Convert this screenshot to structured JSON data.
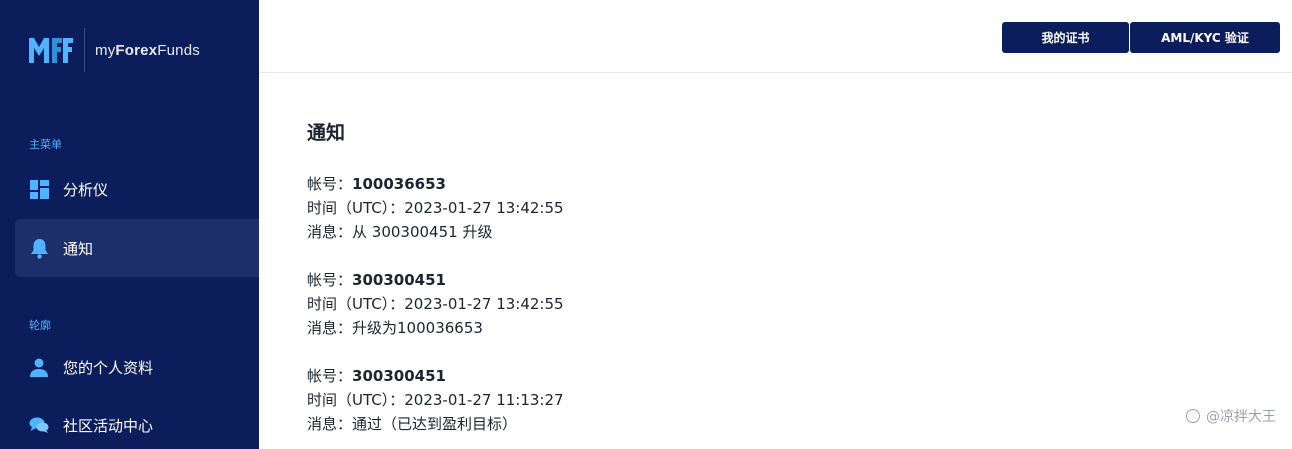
{
  "brand": {
    "name_prefix": "my",
    "name_bold": "Forex",
    "name_suffix": "Funds"
  },
  "sidebar": {
    "section_main": "主菜单",
    "section_profile": "轮廓",
    "items": [
      {
        "label": "分析仪",
        "icon": "dashboard-icon"
      },
      {
        "label": "通知",
        "icon": "bell-icon",
        "active": true
      },
      {
        "label": "您的个人资料",
        "icon": "user-icon"
      },
      {
        "label": "社区活动中心",
        "icon": "chat-icon"
      }
    ]
  },
  "header": {
    "btn_certificate": "我的证书",
    "btn_kyc": "AML/KYC 验证"
  },
  "main": {
    "title": "通知",
    "notices": [
      {
        "account_label": "帐号：",
        "account": "100036653",
        "time_label": "时间（UTC）：",
        "time": "2023-01-27 13:42:55",
        "message_label": "消息：",
        "message": "从 300300451 升级"
      },
      {
        "account_label": "帐号：",
        "account": "300300451",
        "time_label": "时间（UTC）：",
        "time": "2023-01-27 13:42:55",
        "message_label": "消息：",
        "message": "升级为100036653"
      },
      {
        "account_label": "帐号：",
        "account": "300300451",
        "time_label": "时间（UTC）：",
        "time": "2023-01-27 11:13:27",
        "message_label": "消息：",
        "message": "通过（已达到盈利目标）"
      }
    ]
  },
  "watermark": "@凉拌大王",
  "colors": {
    "sidebar_bg": "#0b1d5b",
    "active_item_bg": "#1d2f6b",
    "accent": "#4fb3ff",
    "button_bg": "#0b1d5b"
  }
}
